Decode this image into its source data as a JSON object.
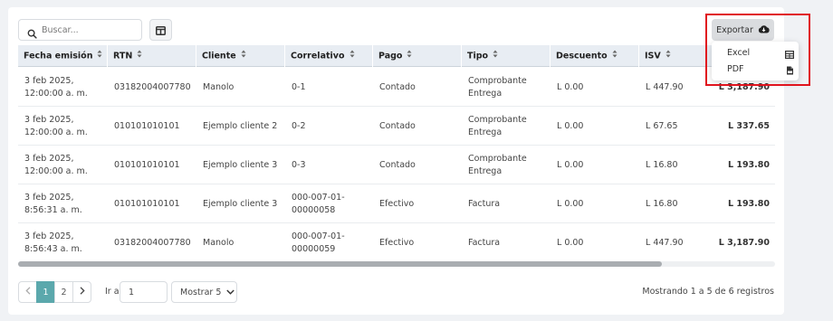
{
  "toolbar": {
    "search_placeholder": "Buscar...",
    "export_label": "Exportar"
  },
  "export_menu": {
    "items": [
      {
        "label": "Excel",
        "icon": "table-icon"
      },
      {
        "label": "PDF",
        "icon": "pdf-file-icon"
      }
    ]
  },
  "table": {
    "columns": [
      "Fecha emisión",
      "RTN",
      "Cliente",
      "Correlativo",
      "Pago",
      "Tipo",
      "Descuento",
      "ISV",
      ""
    ],
    "rows": [
      {
        "fecha": "3 feb 2025, 12:00:00 a. m.",
        "rtn": "03182004007780",
        "cliente": "Manolo",
        "correlativo": "0-1",
        "pago": "Contado",
        "tipo": "Comprobante Entrega",
        "descuento": "L 0.00",
        "isv": "L 447.90",
        "total": "L 3,187.90"
      },
      {
        "fecha": "3 feb 2025, 12:00:00 a. m.",
        "rtn": "010101010101",
        "cliente": "Ejemplo cliente 2",
        "correlativo": "0-2",
        "pago": "Contado",
        "tipo": "Comprobante Entrega",
        "descuento": "L 0.00",
        "isv": "L 67.65",
        "total": "L 337.65"
      },
      {
        "fecha": "3 feb 2025, 12:00:00 a. m.",
        "rtn": "010101010101",
        "cliente": "Ejemplo cliente 3",
        "correlativo": "0-3",
        "pago": "Contado",
        "tipo": "Comprobante Entrega",
        "descuento": "L 0.00",
        "isv": "L 16.80",
        "total": "L 193.80"
      },
      {
        "fecha": "3 feb 2025, 8:56:31 a. m.",
        "rtn": "010101010101",
        "cliente": "Ejemplo cliente 3",
        "correlativo": "000-007-01-00000058",
        "pago": "Efectivo",
        "tipo": "Factura",
        "descuento": "L 0.00",
        "isv": "L 16.80",
        "total": "L 193.80"
      },
      {
        "fecha": "3 feb 2025, 8:56:43 a. m.",
        "rtn": "03182004007780",
        "cliente": "Manolo",
        "correlativo": "000-007-01-00000059",
        "pago": "Efectivo",
        "tipo": "Factura",
        "descuento": "L 0.00",
        "isv": "L 447.90",
        "total": "L 3,187.90"
      }
    ]
  },
  "pagination": {
    "pages": [
      "1",
      "2"
    ],
    "current_page": "1",
    "goto_label": "Ir a:",
    "goto_value": "1",
    "page_size_label": "Mostrar 5",
    "summary": "Mostrando 1 a 5 de 6 registros"
  },
  "colors": {
    "accent": "#5ba8ac",
    "header_bg": "#e8edf3",
    "highlight": "#e0141e"
  }
}
